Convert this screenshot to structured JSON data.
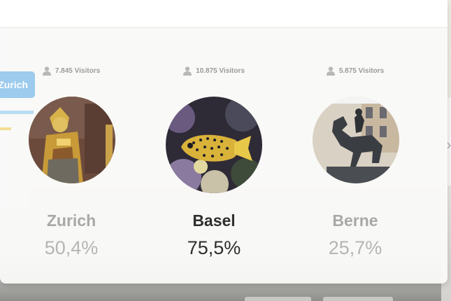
{
  "background": {
    "partial_button_label": "Zurich"
  },
  "cities": [
    {
      "name": "Zurich",
      "visitors": "7.845  Visitors",
      "percent": "50,4%",
      "photo": "golden-statue",
      "active": false
    },
    {
      "name": "Basel",
      "visitors": "10.875  Visitors",
      "percent": "75,5%",
      "photo": "boxfish",
      "active": true
    },
    {
      "name": "Berne",
      "visitors": "5.875  Visitors",
      "percent": "25,7%",
      "photo": "horse-statue",
      "active": false
    }
  ],
  "colors": {
    "active_text": "#2f2f2f",
    "inactive_name": "#a8a8a8",
    "inactive_percent": "#b5b5b5",
    "visitor_text": "#9a9a9a",
    "accent_blue": "#8cc3ec"
  }
}
